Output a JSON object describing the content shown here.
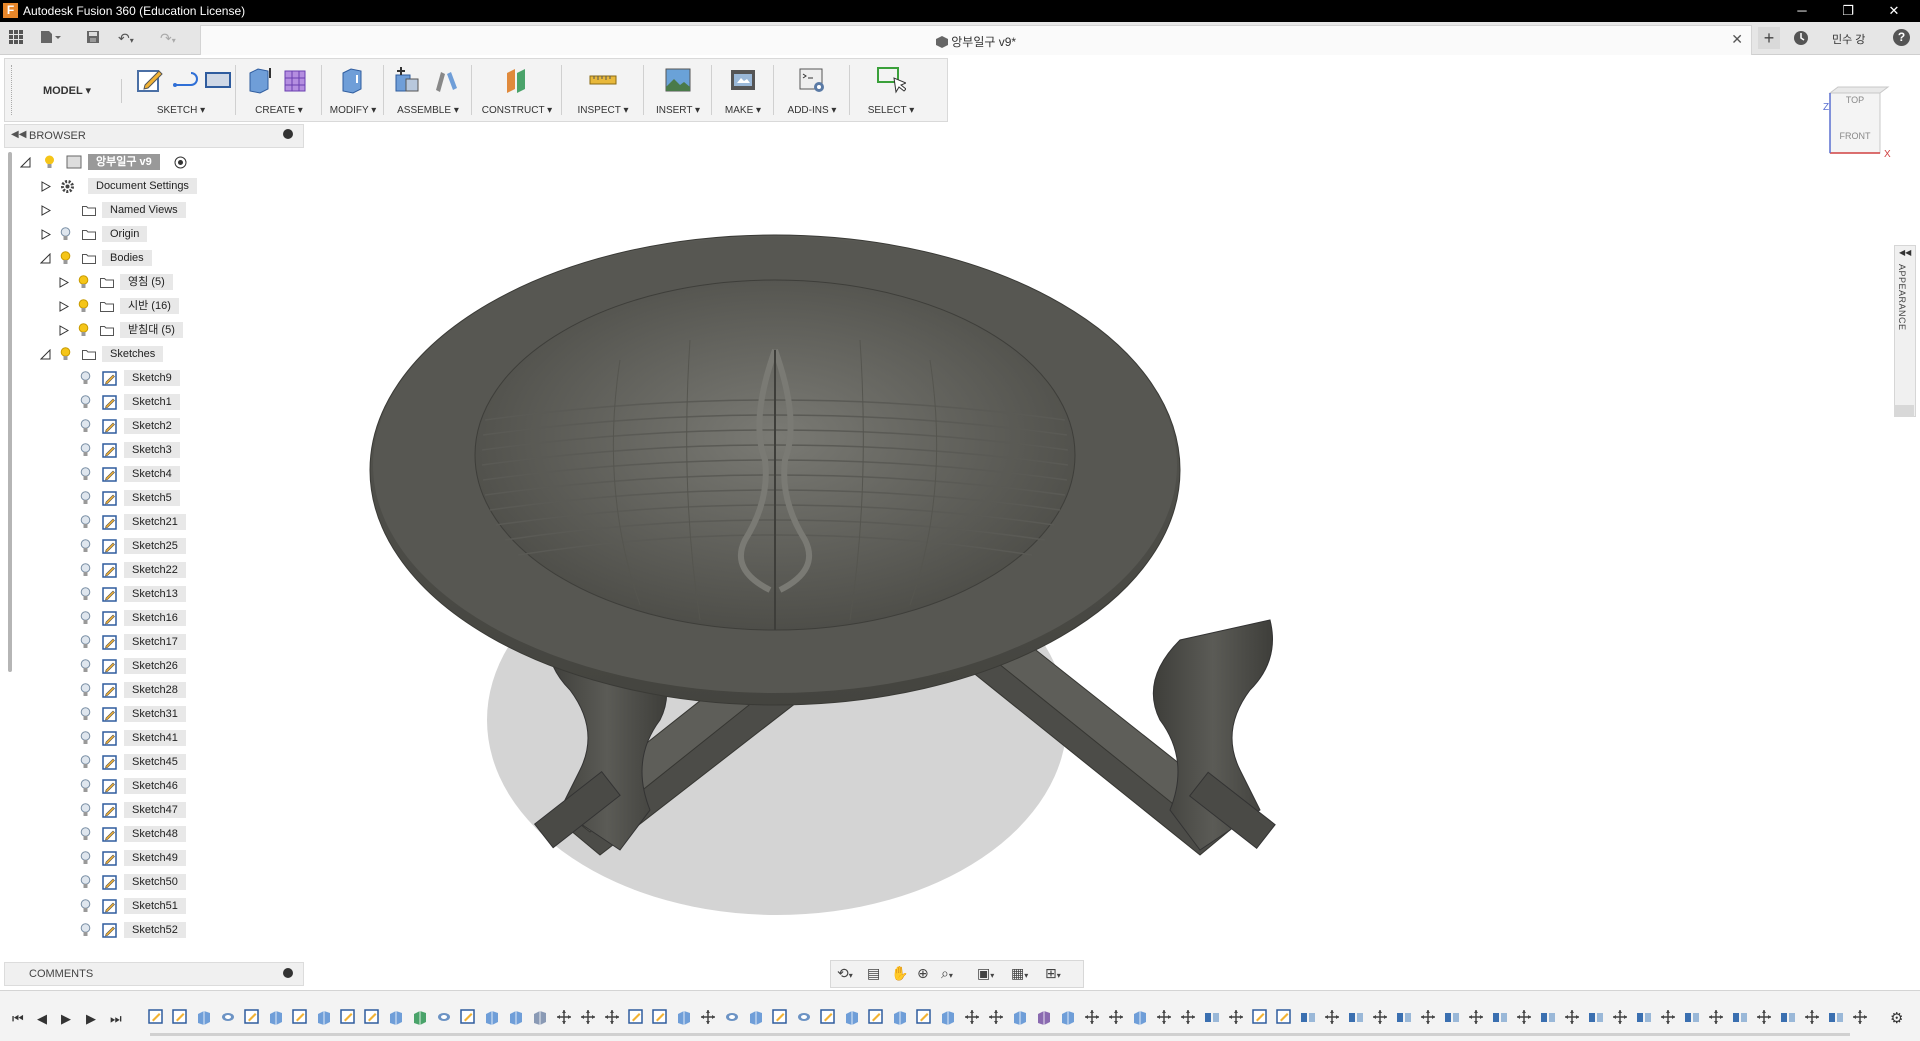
{
  "window": {
    "title": "Autodesk Fusion 360 (Education License)",
    "app_icon_letter": "F"
  },
  "tab": {
    "document_title": "앙부일구 v9*",
    "user_name": "민수 강",
    "help_label": "?"
  },
  "toolbar": {
    "workspace": "MODEL",
    "groups": [
      {
        "label": "SKETCH"
      },
      {
        "label": "CREATE"
      },
      {
        "label": "MODIFY"
      },
      {
        "label": "ASSEMBLE"
      },
      {
        "label": "CONSTRUCT"
      },
      {
        "label": "INSPECT"
      },
      {
        "label": "INSERT"
      },
      {
        "label": "MAKE"
      },
      {
        "label": "ADD-INS"
      },
      {
        "label": "SELECT"
      }
    ]
  },
  "browser": {
    "title": "BROWSER",
    "root": "앙부일구 v9",
    "items": [
      {
        "label": "Document Settings",
        "kind": "settings",
        "level": 1,
        "expand": "closed"
      },
      {
        "label": "Named Views",
        "kind": "folder",
        "level": 1,
        "expand": "closed"
      },
      {
        "label": "Origin",
        "kind": "folder",
        "level": 1,
        "expand": "closed",
        "bulb": "off"
      },
      {
        "label": "Bodies",
        "kind": "folder",
        "level": 1,
        "expand": "open",
        "bulb": "on"
      },
      {
        "label": "영침 (5)",
        "kind": "folder",
        "level": 2,
        "expand": "closed",
        "bulb": "on"
      },
      {
        "label": "시반 (16)",
        "kind": "folder",
        "level": 2,
        "expand": "closed",
        "bulb": "on"
      },
      {
        "label": "받침대 (5)",
        "kind": "folder",
        "level": 2,
        "expand": "closed",
        "bulb": "on"
      },
      {
        "label": "Sketches",
        "kind": "folder",
        "level": 1,
        "expand": "open",
        "bulb": "on"
      }
    ],
    "sketches": [
      "Sketch9",
      "Sketch1",
      "Sketch2",
      "Sketch3",
      "Sketch4",
      "Sketch5",
      "Sketch21",
      "Sketch25",
      "Sketch22",
      "Sketch13",
      "Sketch16",
      "Sketch17",
      "Sketch26",
      "Sketch28",
      "Sketch31",
      "Sketch41",
      "Sketch45",
      "Sketch46",
      "Sketch47",
      "Sketch48",
      "Sketch49",
      "Sketch50",
      "Sketch51",
      "Sketch52"
    ]
  },
  "comments": {
    "title": "COMMENTS"
  },
  "viewcube": {
    "top": "TOP",
    "front": "FRONT",
    "axis_z": "Z",
    "axis_x": "X"
  },
  "side_panel": {
    "label": "APPEARANCE"
  },
  "colors": {
    "model": "#4a4a46",
    "model_light": "#6a6a64",
    "shadow": "#d0d0d0",
    "accent": "#e8872a"
  }
}
